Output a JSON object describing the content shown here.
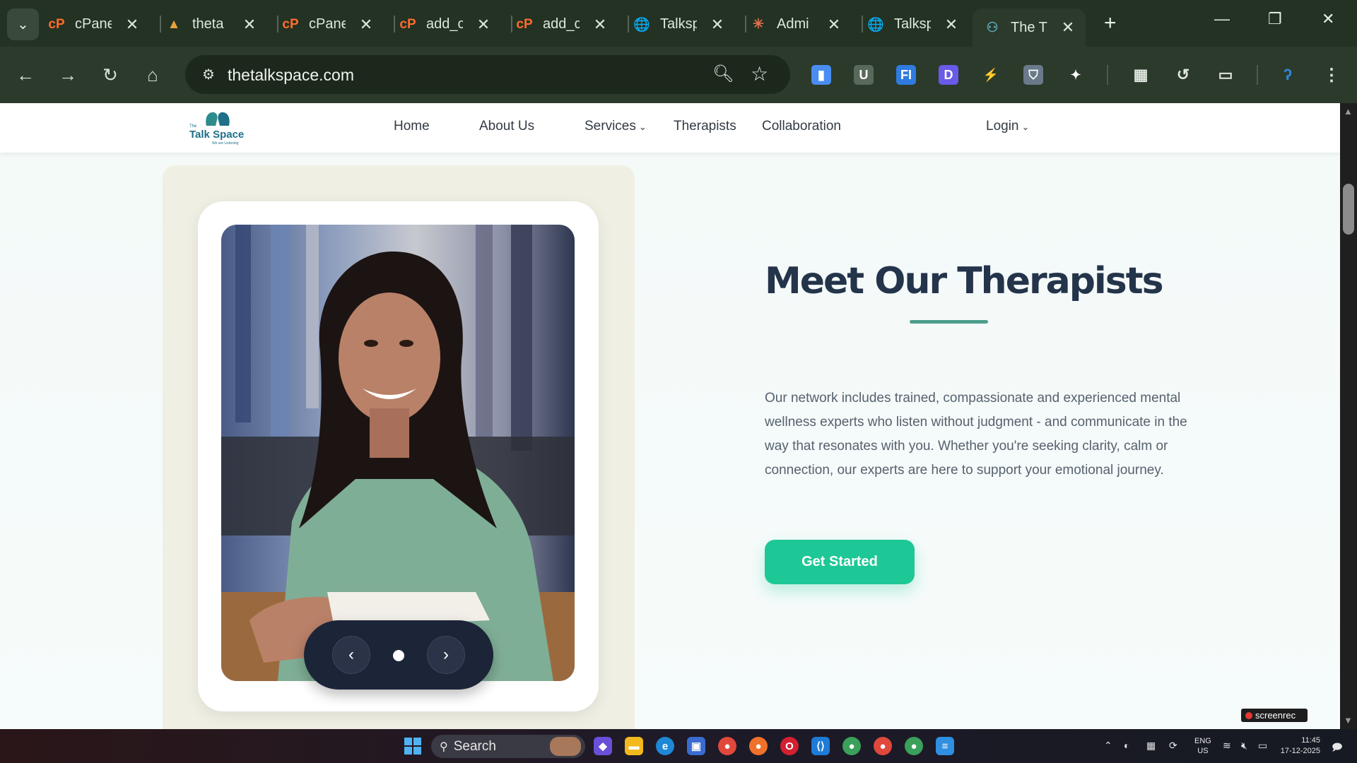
{
  "browser": {
    "tab_search_icon": "chevron-down-icon",
    "tabs": [
      {
        "label": "cPanel",
        "favicon": "cpanel-icon",
        "favicon_text": "cP",
        "color": "#ff6c2c"
      },
      {
        "label": "theta",
        "favicon": "mountain-logo-icon",
        "favicon_text": "▲",
        "color": "#e8a23a"
      },
      {
        "label": "cPanel",
        "favicon": "cpanel-icon",
        "favicon_text": "cP",
        "color": "#ff6c2c"
      },
      {
        "label": "add_c",
        "favicon": "cpanel-icon",
        "favicon_text": "cP",
        "color": "#ff6c2c"
      },
      {
        "label": "add_c",
        "favicon": "cpanel-icon",
        "favicon_text": "cP",
        "color": "#ff6c2c"
      },
      {
        "label": "Talksp",
        "favicon": "globe-icon",
        "favicon_text": "🌐",
        "color": "#cfd8cf"
      },
      {
        "label": "Admi",
        "favicon": "asterisk-icon",
        "favicon_text": "✳",
        "color": "#e07050"
      },
      {
        "label": "Talksp",
        "favicon": "globe-icon",
        "favicon_text": "🌐",
        "color": "#cfd8cf"
      },
      {
        "label": "The T",
        "favicon": "talkspace-icon",
        "favicon_text": "⚇",
        "color": "#5aa6b8",
        "active": true
      }
    ],
    "new_tab_label": "+",
    "window_controls": {
      "minimize": "—",
      "restore": "❐",
      "close": "✕"
    },
    "address": {
      "url": "thetalkspace.com"
    },
    "nav_icons": {
      "back": "←",
      "forward": "→",
      "reload": "↻",
      "home": "⌂"
    },
    "extensions": [
      {
        "name": "docs-extension-icon",
        "glyph": "▮",
        "color": "#4a8df0"
      },
      {
        "name": "u-extension-icon",
        "glyph": "U",
        "color": "#5a6a5a"
      },
      {
        "name": "fi-extension-icon",
        "glyph": "FI",
        "color": "#2f7be0"
      },
      {
        "name": "d-extension-icon",
        "glyph": "D",
        "color": "#6a5ae8"
      },
      {
        "name": "lightning-extension-icon",
        "glyph": "⚡",
        "color": "#2b3a2b"
      },
      {
        "name": "shield-extension-icon",
        "glyph": "⛉",
        "color": "#6a7a8a"
      },
      {
        "name": "puzzle-extensions-icon",
        "glyph": "✦",
        "color": "#2b3a2b"
      }
    ]
  },
  "site": {
    "logo": {
      "the": "The",
      "brand": "Talk Space",
      "tagline": "We are Listening"
    },
    "nav": {
      "home": "Home",
      "about": "About Us",
      "services": "Services",
      "therapists": "Therapists",
      "collaboration": "Collaboration",
      "login": "Login"
    },
    "hero": {
      "title": "Meet Our Therapists",
      "description": "Our network includes trained, compassionate and experienced mental wellness experts who listen without judgment - and communicate in the way that resonates with you. Whether you're seeking clarity, calm or connection, our experts are here to support your emotional journey.",
      "cta": "Get Started"
    },
    "carousel": {
      "prev": "‹",
      "next": "›",
      "active_slide": 1,
      "slide_count": 1
    }
  },
  "screenrec_label": "screenrec",
  "taskbar": {
    "search_placeholder": "Search",
    "language": "ENG",
    "region": "US",
    "time": "11:45",
    "date": "17-12-2025"
  }
}
